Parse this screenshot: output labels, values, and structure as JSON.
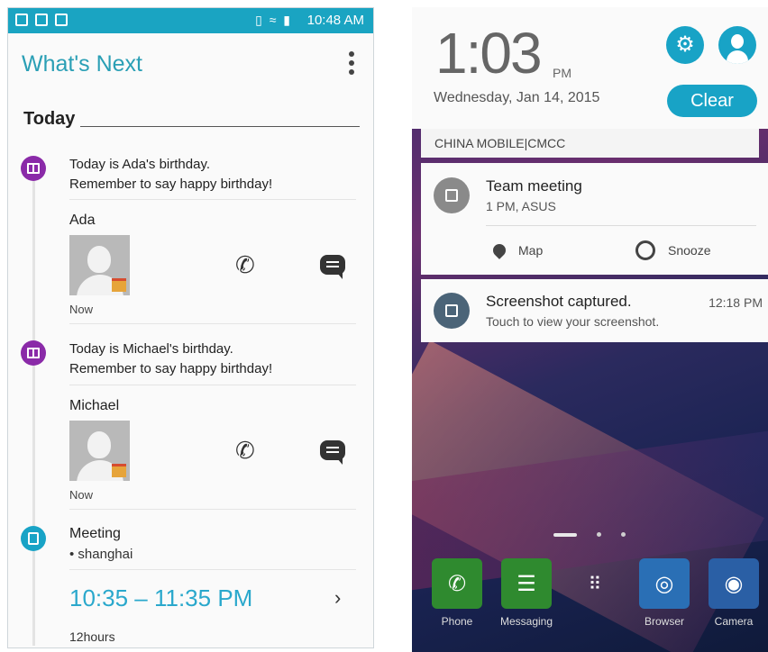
{
  "left": {
    "status_time": "10:48 AM",
    "app_title": "What's Next",
    "section": "Today",
    "events": [
      {
        "line1": "Today is Ada's birthday.",
        "line2": "Remember to say happy birthday!",
        "contact": "Ada",
        "when": "Now"
      },
      {
        "line1": "Today is Michael's birthday.",
        "line2": "Remember to say happy birthday!",
        "contact": "Michael",
        "when": "Now"
      }
    ],
    "meeting": {
      "title": "Meeting",
      "location": "• shanghai",
      "time": "10:35 – 11:35 PM",
      "duration": "12hours"
    }
  },
  "right": {
    "clock": "1:03",
    "ampm": "PM",
    "date": "Wednesday, Jan 14, 2015",
    "clear_label": "Clear",
    "carrier": "CHINA MOBILE|CMCC",
    "notifications": [
      {
        "title": "Team meeting",
        "sub": "1 PM, ASUS",
        "actions": [
          "Map",
          "Snooze"
        ]
      },
      {
        "title": "Screenshot captured.",
        "sub": "Touch to view your screenshot.",
        "time": "12:18 PM"
      }
    ],
    "dock": [
      {
        "label": "Phone",
        "color": "#2f8a2f"
      },
      {
        "label": "Messaging",
        "color": "#2f8a2f"
      },
      {
        "label": "",
        "color": "transparent"
      },
      {
        "label": "Browser",
        "color": "#2a6fb5"
      },
      {
        "label": "Camera",
        "color": "#2a5fa5"
      }
    ]
  }
}
